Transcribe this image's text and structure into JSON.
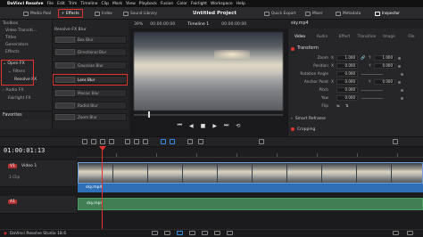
{
  "menubar": {
    "app": "DaVinci Resolve",
    "items": [
      "File",
      "Edit",
      "Trim",
      "Timeline",
      "Clip",
      "Mark",
      "View",
      "Playback",
      "Fusion",
      "Color",
      "Fairlight",
      "Workspace",
      "Help"
    ]
  },
  "toolbar": {
    "media_pool": "Media Pool",
    "effects": "Effects",
    "index": "Index",
    "sound_library": "Sound Library",
    "project_title": "Untitled Project",
    "quick_export": "Quick Export",
    "mixer": "Mixer",
    "metadata": "Metadata",
    "inspector": "Inspector"
  },
  "effects_panel": {
    "tree": [
      "Toolbox",
      "Video Transiti...",
      "Titles",
      "Generators",
      "Effects",
      "Open FX",
      "Filters",
      "Resolve FX",
      "Audio FX",
      "Fairlight FX"
    ],
    "favorites": "Favorites",
    "list_header": "Resolve FX Blur",
    "items": [
      "Box Blur",
      "Directional Blur",
      "Gaussian Blur",
      "Lens Blur",
      "Mosaic Blur",
      "Radial Blur",
      "Zoom Blur"
    ]
  },
  "viewer": {
    "zoom": "39%",
    "size": "00:00:00:00",
    "timeline_name": "Timeline 1",
    "timecode": "00:00:00:00"
  },
  "inspector": {
    "clip_name": "sky.mp4",
    "tabs": [
      "Video",
      "Audio",
      "Effect",
      "Transition",
      "Image",
      "File"
    ],
    "transform": "Transform",
    "params": [
      {
        "label": "Zoom",
        "a": "X",
        "av": "1.000",
        "b": "Y",
        "bv": "1.000"
      },
      {
        "label": "Position",
        "a": "X",
        "av": "0.000",
        "b": "Y",
        "bv": "0.000"
      },
      {
        "label": "Rotation Angle",
        "av": "0.000"
      },
      {
        "label": "Anchor Point",
        "a": "X",
        "av": "0.000",
        "b": "Y",
        "bv": "0.000"
      },
      {
        "label": "Pitch",
        "av": "0.000"
      },
      {
        "label": "Yaw",
        "av": "0.000"
      },
      {
        "label": "Flip"
      }
    ],
    "smart_reframe": "Smart Reframe",
    "cropping": "Cropping"
  },
  "timeline": {
    "timecode": "01:00:01:13",
    "video_track": "V1",
    "video_track_name": "Video 1",
    "video_clip_count": "1 Clip",
    "audio_track": "A1",
    "video_clip_label": "sky.mp4",
    "audio_clip_label": "sky.mp4"
  },
  "bottombar": {
    "app_version": "DaVinci Resolve Studio 18.6"
  },
  "colors": {
    "highlight": "#e0332f",
    "accent_blue": "#3a8ee6",
    "video_clip": "#2f6fb5",
    "audio_clip": "#3f7f53"
  }
}
